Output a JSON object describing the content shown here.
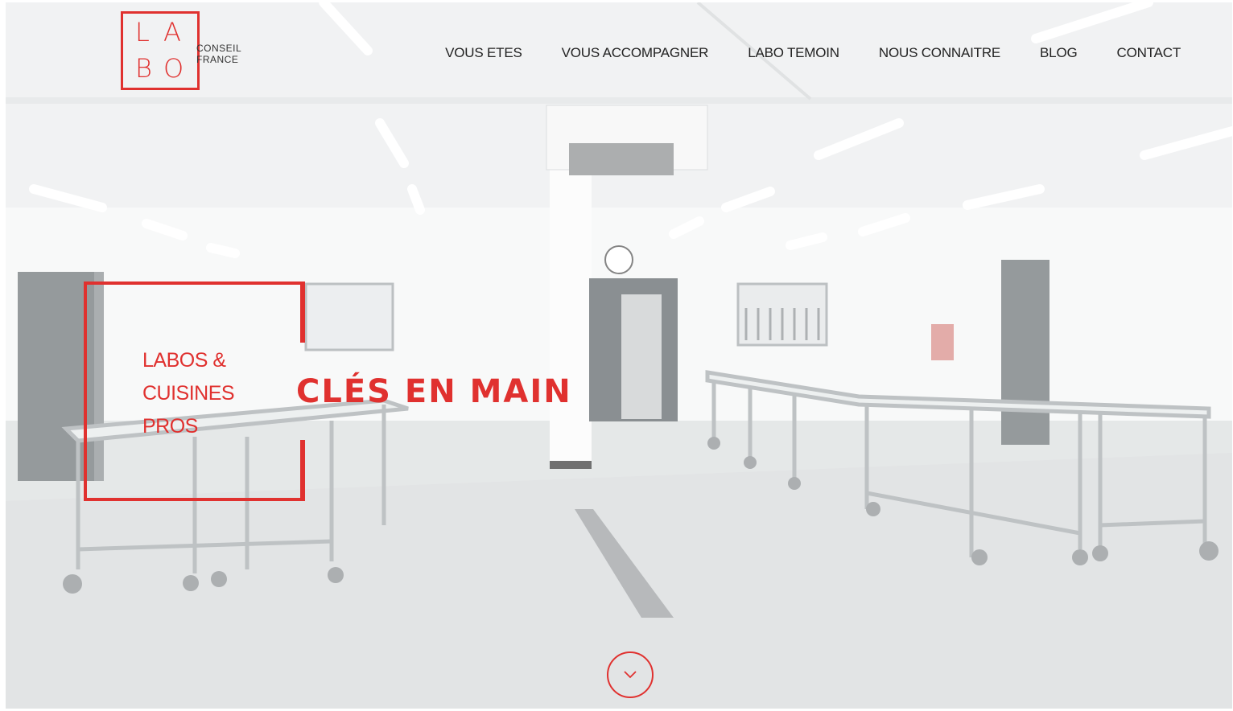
{
  "logo": {
    "letters": [
      "L",
      "A",
      "B",
      "O"
    ],
    "line1": "CONSEIL",
    "line2": "FRANCE"
  },
  "nav": {
    "items": [
      {
        "label": "VOUS ETES"
      },
      {
        "label": "VOUS ACCOMPAGNER"
      },
      {
        "label": "LABO TEMOIN"
      },
      {
        "label": "NOUS CONNAITRE"
      },
      {
        "label": "BLOG"
      },
      {
        "label": "CONTACT"
      }
    ]
  },
  "hero": {
    "subtitle_lines": [
      "LABOS &",
      "CUISINES",
      "PROS"
    ],
    "title": "CLÉS EN MAIN"
  },
  "scroll": {
    "icon": "chevron-down-icon"
  },
  "colors": {
    "accent": "#e0312f",
    "nav_text": "#222222",
    "background": "#eef0f1"
  }
}
